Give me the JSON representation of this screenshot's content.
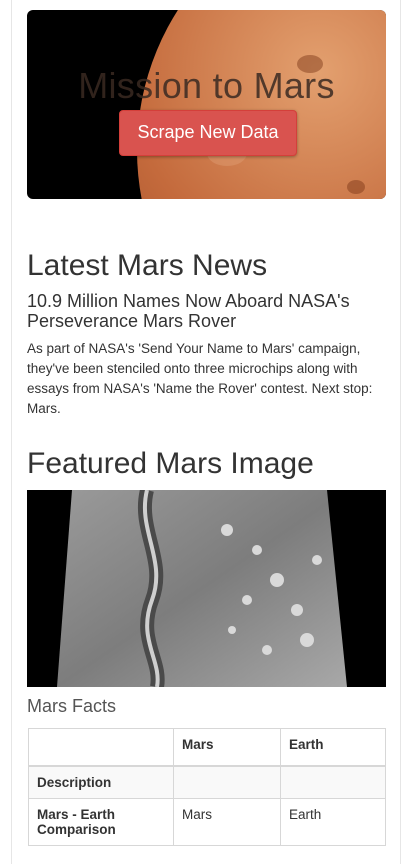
{
  "hero": {
    "title": "Mission to Mars",
    "button_label": "Scrape New Data"
  },
  "news": {
    "section_title": "Latest Mars News",
    "headline": "10.9 Million Names Now Aboard NASA's Perseverance Mars Rover",
    "teaser": "As part of NASA's 'Send Your Name to Mars' campaign, they've been stenciled onto three microchips along with essays from NASA's 'Name the Rover' contest. Next stop: Mars."
  },
  "featured": {
    "section_title": "Featured Mars Image",
    "icon": "mars-surface-image"
  },
  "facts": {
    "caption": "Mars Facts",
    "columns": [
      "",
      "Mars",
      "Earth"
    ],
    "rows": [
      {
        "label": "Description",
        "mars": "",
        "earth": ""
      },
      {
        "label": "Mars - Earth Comparison",
        "mars": "Mars",
        "earth": "Earth"
      }
    ]
  },
  "colors": {
    "button": "#d9534f",
    "hero_bg": "#000000",
    "mars": "#c46a3c"
  }
}
